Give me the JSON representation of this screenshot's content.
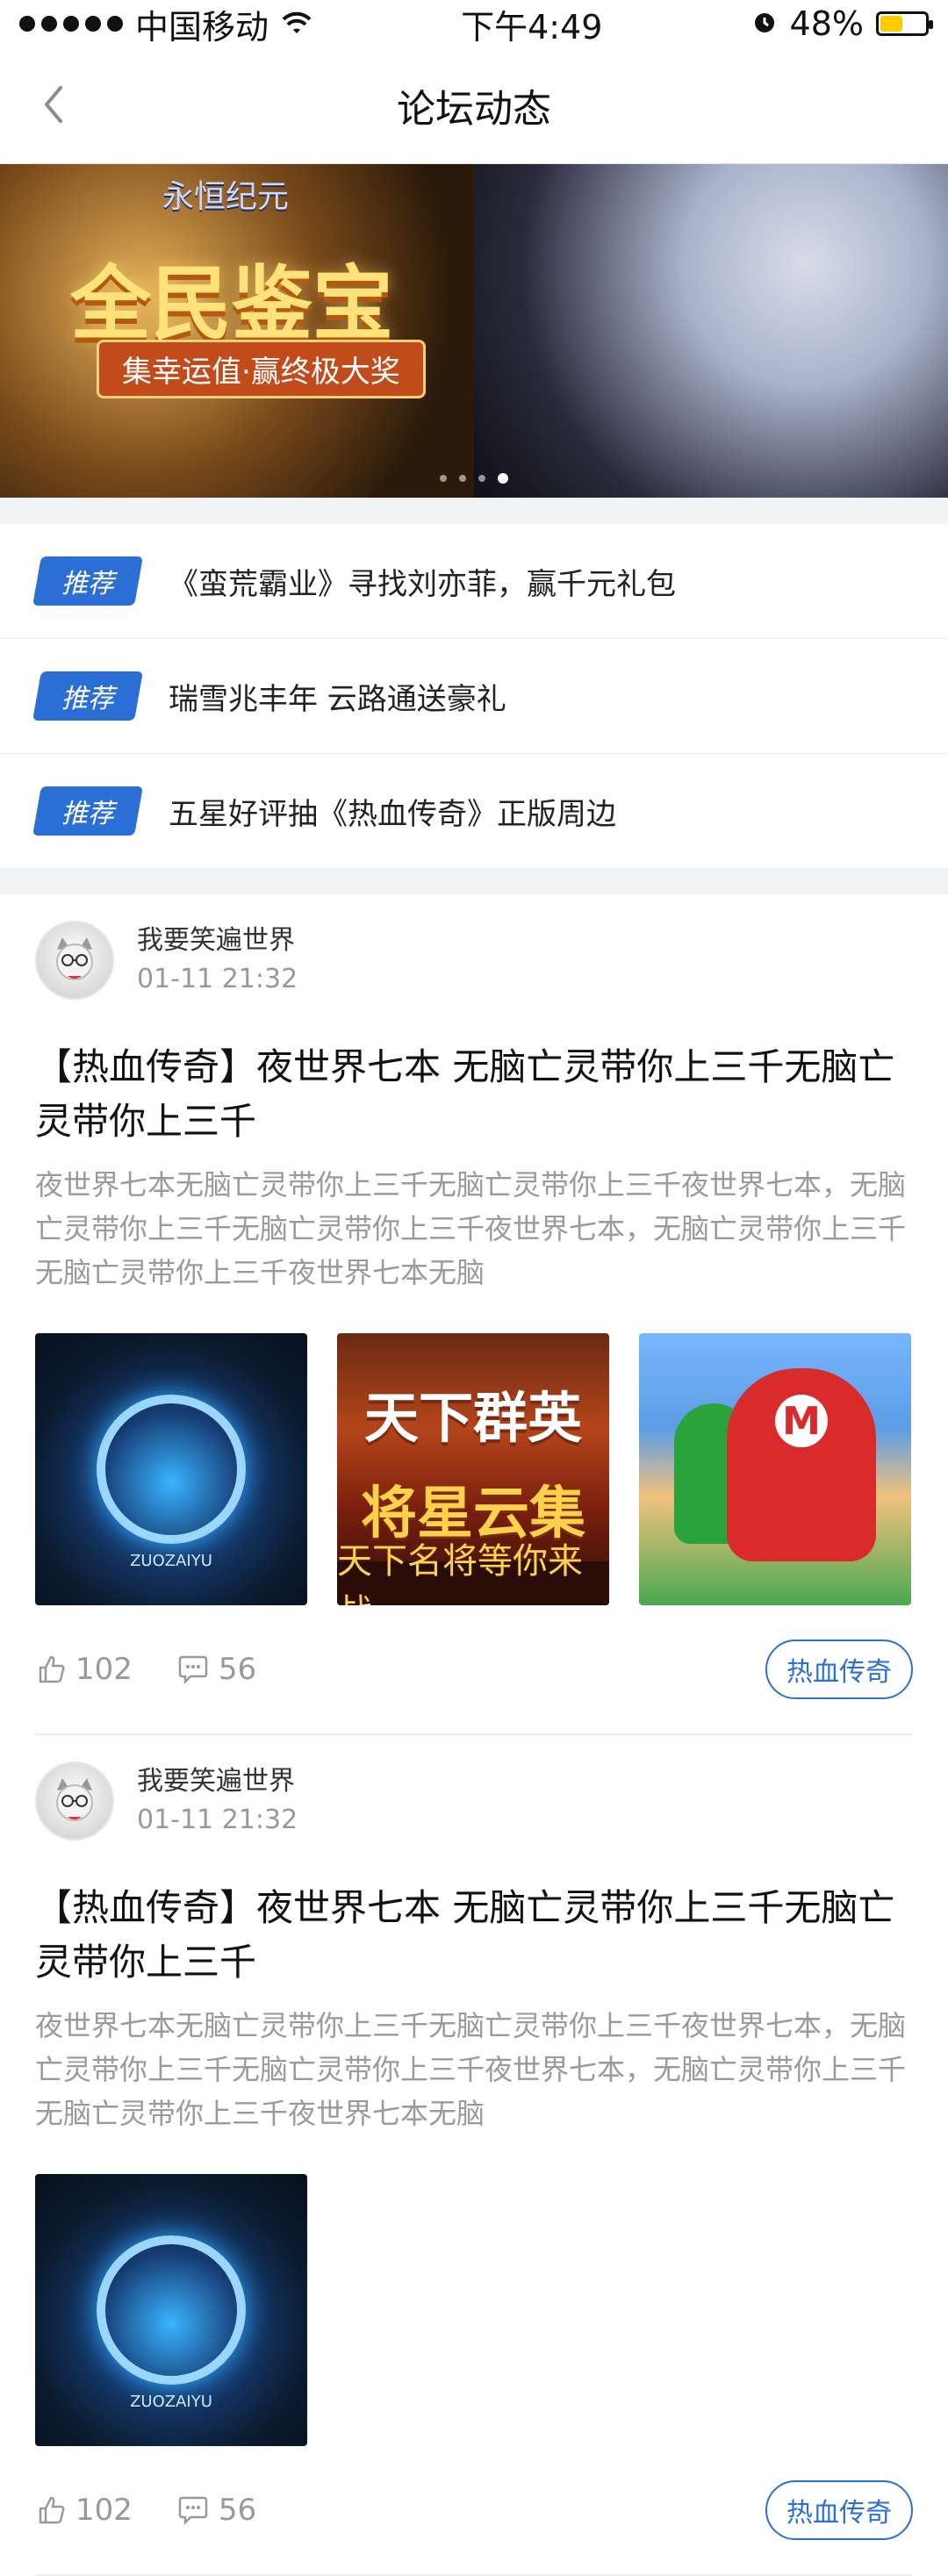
{
  "statusbar": {
    "carrier": "中国移动",
    "time": "下午4:49",
    "battery": "48%",
    "battery_level": 0.48,
    "battery_color": "#ffcc00"
  },
  "navbar": {
    "title": "论坛动态"
  },
  "banner": {
    "heading": "全民鉴宝",
    "subtitle": "集幸运值·赢终极大奖",
    "logo_text": "永恒纪元",
    "pages": 4,
    "active_page": 4
  },
  "recommendations": [
    {
      "tag": "推荐",
      "text": "《蛮荒霸业》寻找刘亦菲，赢千元礼包"
    },
    {
      "tag": "推荐",
      "text": "瑞雪兆丰年 云路通送豪礼"
    },
    {
      "tag": "推荐",
      "text": "五星好评抽《热血传奇》正版周边"
    }
  ],
  "posts": [
    {
      "author": "我要笑遍世界",
      "time": "01-11 21:32",
      "title": "【热血传奇】夜世界七本 无脑亡灵带你上三千无脑亡灵带你上三千",
      "body": "夜世界七本无脑亡灵带你上三千无脑亡灵带你上三千夜世界七本，无脑亡灵带你上三千无脑亡灵带你上三千夜世界七本，无脑亡灵带你上三千无脑亡灵带你上三千夜世界七本无脑",
      "images": [
        {
          "alt": "game-emblem",
          "caption": "ZUOZAIYU"
        },
        {
          "alt": "game-poster-tianxiaqunying",
          "title": "天下群英",
          "headline": "将星云集",
          "tagline": "天下名将等你来战"
        },
        {
          "alt": "mario-art"
        }
      ],
      "likes": "102",
      "comments": "56",
      "topic": "热血传奇"
    },
    {
      "author": "我要笑遍世界",
      "time": "01-11 21:32",
      "title": "【热血传奇】夜世界七本 无脑亡灵带你上三千无脑亡灵带你上三千",
      "body": "夜世界七本无脑亡灵带你上三千无脑亡灵带你上三千夜世界七本，无脑亡灵带你上三千无脑亡灵带你上三千夜世界七本，无脑亡灵带你上三千无脑亡灵带你上三千夜世界七本无脑",
      "images": [
        {
          "alt": "game-emblem",
          "caption": "ZUOZAIYU"
        }
      ],
      "likes": "102",
      "comments": "56",
      "topic": "热血传奇"
    }
  ],
  "colors": {
    "accent": "#2b6fd6",
    "text_primary": "#111111",
    "text_secondary": "#9a9a9a",
    "divider": "#ececec",
    "background": "#f2f3f5"
  },
  "icons": {
    "back": "chevron-left-icon",
    "wifi": "wifi-icon",
    "alarm": "alarm-icon",
    "like": "thumbs-up-icon",
    "comment": "comment-icon"
  }
}
